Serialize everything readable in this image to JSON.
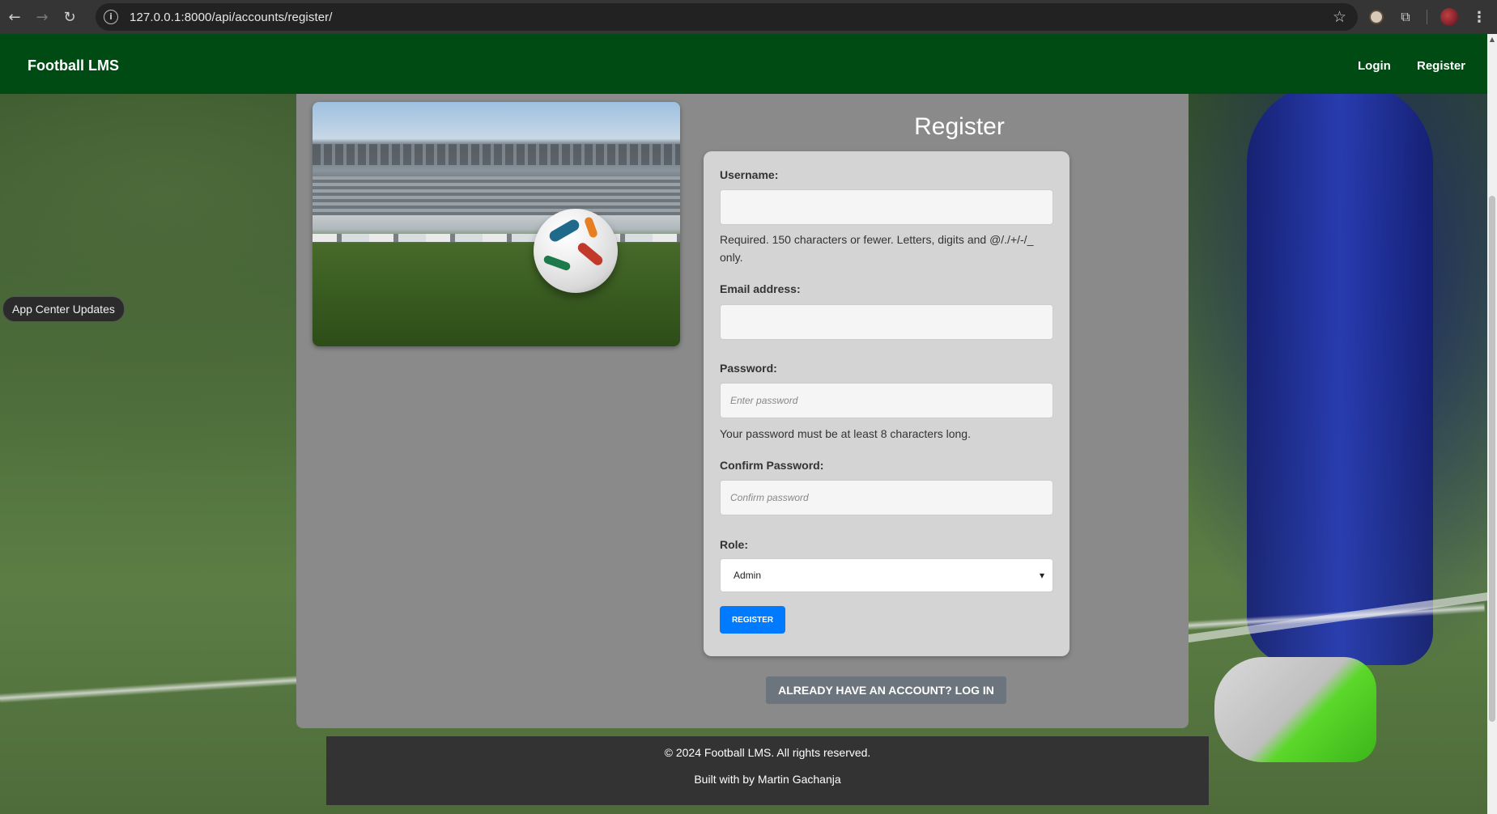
{
  "browser": {
    "url": "127.0.0.1:8000/api/accounts/register/",
    "back_icon": "←",
    "forward_icon": "→",
    "reload_icon": "↻",
    "info_icon": "i",
    "star_icon": "☆",
    "extensions_icon": "⧉",
    "menu_icon": "⋮"
  },
  "navbar": {
    "brand": "Football LMS",
    "links": [
      "Login",
      "Register"
    ],
    "color": "#004b14"
  },
  "overlay": {
    "app_center_label": "App Center Updates"
  },
  "form": {
    "title": "Register",
    "username_label": "Username:",
    "username_help": "Required. 150 characters or fewer. Letters, digits and @/./+/-/_ only.",
    "email_label": "Email address:",
    "password_label": "Password:",
    "password_placeholder": "Enter password",
    "password_help": "Your password must be at least 8 characters long.",
    "confirm_label": "Confirm Password:",
    "confirm_placeholder": "Confirm password",
    "role_label": "Role:",
    "role_value": "Admin",
    "submit_label": "REGISTER",
    "login_link": "ALREADY HAVE AN ACCOUNT? LOG IN",
    "submit_color": "#007bff"
  },
  "footer": {
    "copyright": "© 2024 Football LMS. All rights reserved.",
    "credit": "Built with by Martin Gachanja"
  }
}
